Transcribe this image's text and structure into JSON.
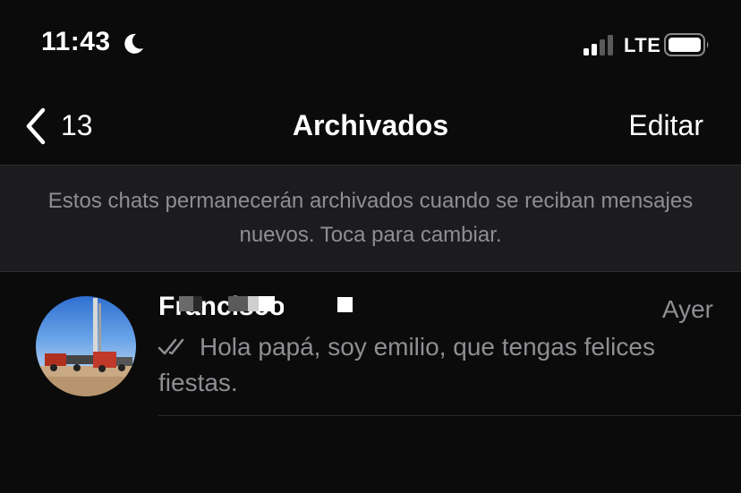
{
  "status_bar": {
    "time": "11:43",
    "network": "LTE",
    "icons": [
      "moon-icon",
      "signal-icon",
      "battery-icon"
    ]
  },
  "nav": {
    "back_count": "13",
    "title": "Archivados",
    "edit_label": "Editar"
  },
  "banner": {
    "text": "Estos chats permanecerán archivados cuando se reciban mensajes nuevos. Toca para cambiar."
  },
  "chats": [
    {
      "name": "Francisco",
      "time": "Ayer",
      "preview": "Hola papá, soy emilio, que tengas felices fiestas.",
      "status_icon": "double-check-icon"
    }
  ],
  "colors": {
    "background": "#0b0b0b",
    "banner": "#1c1c1e",
    "secondary_text": "#8e8e93",
    "divider": "#2c2c2e"
  }
}
